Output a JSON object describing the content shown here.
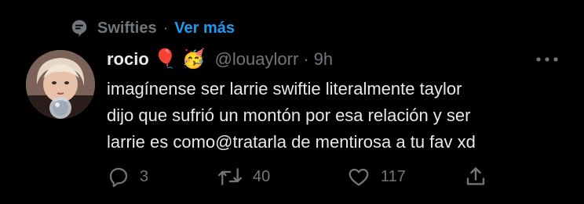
{
  "context": {
    "community": "Swifties",
    "separator": "·",
    "link": "Ver más",
    "icon": "community-icon"
  },
  "tweet": {
    "display_name": "rocio",
    "emojis": [
      "🎈",
      "🥳"
    ],
    "handle": "@louaylorr",
    "meta_separator": "·",
    "time": "9h",
    "text_lines": [
      "imagínense ser larrie swiftie literalmente taylor",
      "dijo que sufrió un montón por esa relación y ser",
      "larrie es como@tratarla de mentirosa a tu fav xd"
    ]
  },
  "actions": {
    "reply_count": "3",
    "retweet_count": "40",
    "like_count": "117",
    "reply_icon": "reply-icon",
    "retweet_icon": "retweet-icon",
    "like_icon": "heart-icon",
    "share_icon": "share-icon"
  },
  "colors": {
    "background": "#000000",
    "text": "#e7e9ea",
    "muted": "#71767b",
    "accent": "#1d9bf0"
  }
}
